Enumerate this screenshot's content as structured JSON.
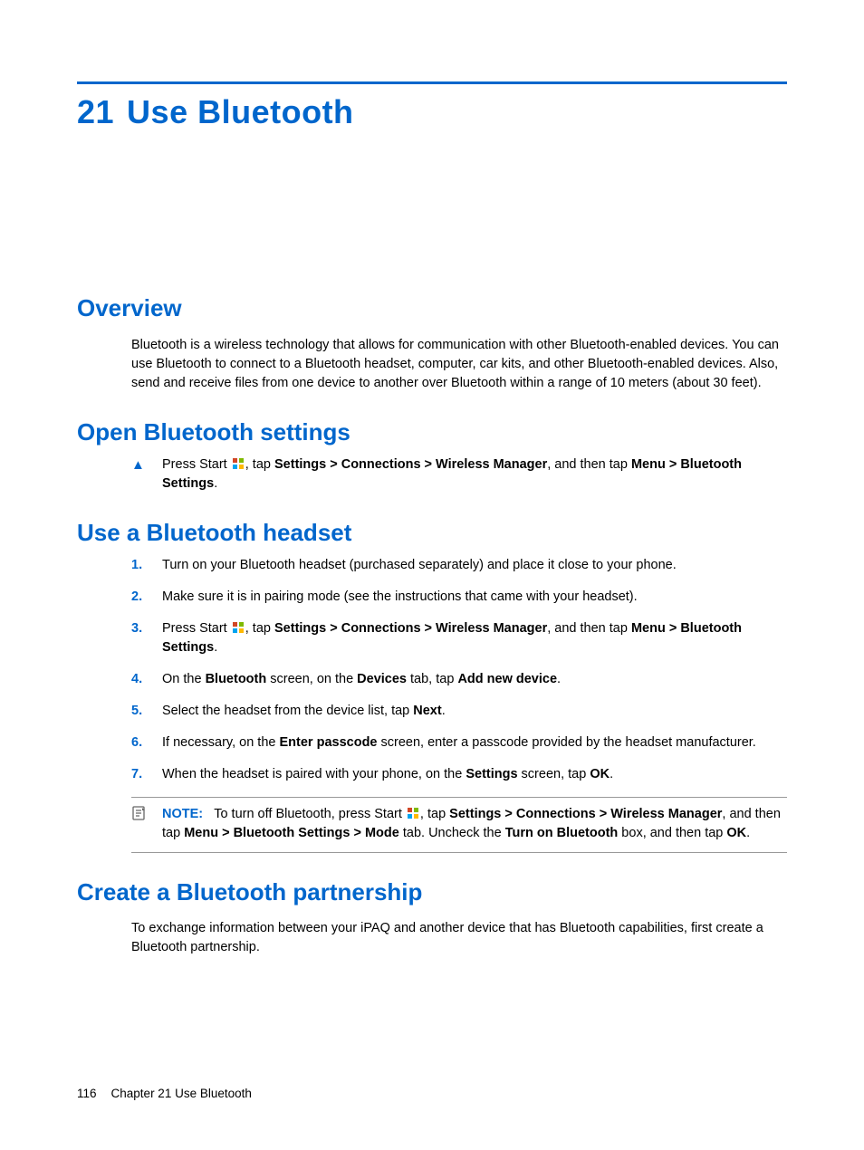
{
  "chapter": {
    "number": "21",
    "title": "Use Bluetooth"
  },
  "sections": {
    "overview": {
      "heading": "Overview",
      "body": "Bluetooth is a wireless technology that allows for communication with other Bluetooth-enabled devices. You can use Bluetooth to connect to a Bluetooth headset, computer, car kits, and other Bluetooth-enabled devices. Also, send and receive files from one device to another over Bluetooth within a range of 10 meters (about 30 feet)."
    },
    "open_settings": {
      "heading": "Open Bluetooth settings",
      "item": {
        "pre": "Press Start ",
        "mid": ", tap ",
        "b1": "Settings > Connections > Wireless Manager",
        "mid2": ", and then tap ",
        "b2": "Menu > Bluetooth Settings",
        "post": "."
      }
    },
    "use_headset": {
      "heading": "Use a Bluetooth headset",
      "steps": {
        "s1": "Turn on your Bluetooth headset (purchased separately) and place it close to your phone.",
        "s2": "Make sure it is in pairing mode (see the instructions that came with your headset).",
        "s3": {
          "pre": "Press Start ",
          "mid": ", tap ",
          "b1": "Settings > Connections > Wireless Manager",
          "mid2": ", and then tap ",
          "b2": "Menu > Bluetooth Settings",
          "post": "."
        },
        "s4": {
          "pre": "On the ",
          "b1": "Bluetooth",
          "mid": " screen, on the ",
          "b2": "Devices",
          "mid2": " tab, tap ",
          "b3": "Add new device",
          "post": "."
        },
        "s5": {
          "pre": "Select the headset from the device list, tap ",
          "b1": "Next",
          "post": "."
        },
        "s6": {
          "pre": "If necessary, on the ",
          "b1": "Enter passcode",
          "post": " screen, enter a passcode provided by the headset manufacturer."
        },
        "s7": {
          "pre": "When the headset is paired with your phone, on the ",
          "b1": "Settings",
          "mid": " screen, tap ",
          "b2": "OK",
          "post": "."
        }
      },
      "note": {
        "label": "NOTE:",
        "pre": "To turn off Bluetooth, press Start ",
        "mid": ", tap ",
        "b1": "Settings > Connections > Wireless Manager",
        "mid2": ", and then tap ",
        "b2": "Menu > Bluetooth Settings > Mode",
        "mid3": " tab. Uncheck the ",
        "b3": "Turn on Bluetooth",
        "mid4": " box, and then tap ",
        "b4": "OK",
        "post": "."
      }
    },
    "partnership": {
      "heading": "Create a Bluetooth partnership",
      "body": "To exchange information between your iPAQ and another device that has Bluetooth capabilities, first create a Bluetooth partnership."
    }
  },
  "footer": {
    "page": "116",
    "text": "Chapter 21   Use Bluetooth"
  },
  "markers": {
    "m1": "1.",
    "m2": "2.",
    "m3": "3.",
    "m4": "4.",
    "m5": "5.",
    "m6": "6.",
    "m7": "7.",
    "tri": "▲"
  }
}
